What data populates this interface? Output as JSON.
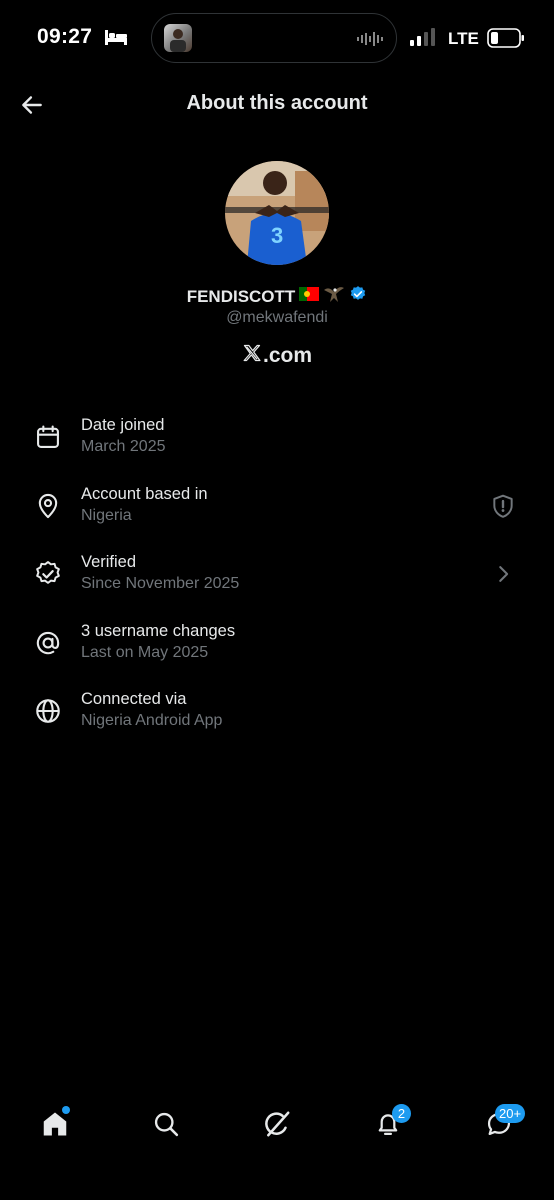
{
  "status_bar": {
    "time": "09:27",
    "network": "LTE",
    "icons": [
      "bed-icon",
      "audio-wave-icon",
      "signal-icon",
      "battery-icon"
    ]
  },
  "header": {
    "title": "About this account",
    "back_icon": "back-arrow-icon"
  },
  "profile": {
    "display_name": "FENDISCOTT",
    "name_emojis": [
      "🇵🇹",
      "🦅"
    ],
    "verified": true,
    "handle": "@mekwafendi",
    "brand": ".com",
    "brand_logo": "x-logo-icon"
  },
  "info_rows": [
    {
      "icon": "calendar-icon",
      "title": "Date joined",
      "subtitle": "March 2025"
    },
    {
      "icon": "location-pin-icon",
      "title": "Account based in",
      "subtitle": "Nigeria",
      "action_icon": "shield-alert-icon"
    },
    {
      "icon": "verified-badge-icon",
      "title": "Verified",
      "subtitle": "Since November 2025",
      "action_icon": "chevron-right-icon"
    },
    {
      "icon": "at-sign-icon",
      "title": "3 username changes",
      "subtitle": "Last on May 2025"
    },
    {
      "icon": "globe-icon",
      "title": "Connected via",
      "subtitle": "Nigeria Android App"
    }
  ],
  "bottom_nav": {
    "items": [
      {
        "icon": "home-icon",
        "has_dot": true
      },
      {
        "icon": "search-icon"
      },
      {
        "icon": "grok-icon"
      },
      {
        "icon": "bell-icon",
        "badge": "2"
      },
      {
        "icon": "messages-icon",
        "badge": "20+"
      }
    ]
  },
  "colors": {
    "background": "#000000",
    "primary_text": "#e7e9ea",
    "secondary_text": "#71767b",
    "accent": "#1d9bf0"
  }
}
